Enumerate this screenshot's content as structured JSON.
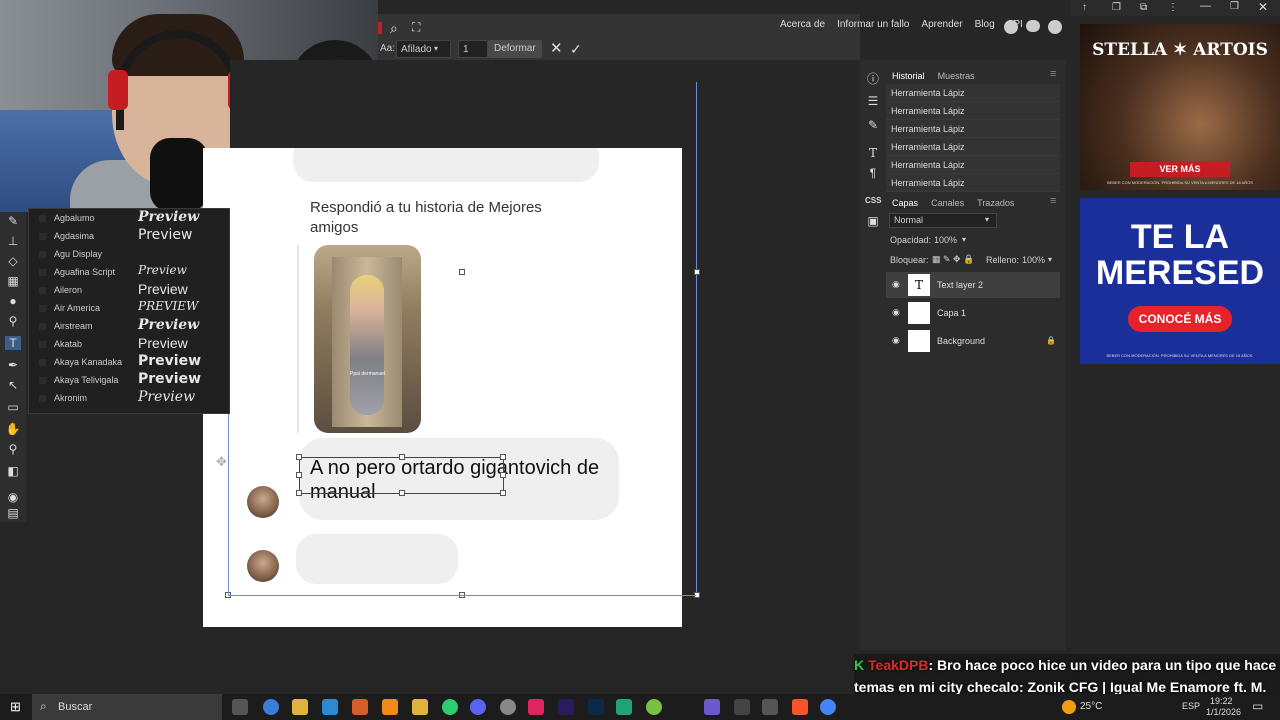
{
  "app": {
    "toolbar": {
      "font_size_label": "Aa:",
      "antialias_value": "Afilado",
      "size_value": "1",
      "deform_label": "Deformar"
    },
    "menu": [
      "Acerca de",
      "Informar un fallo",
      "Aprender",
      "Blog",
      "API"
    ],
    "font_list": [
      {
        "name": "Agbalumo",
        "preview": "Preview"
      },
      {
        "name": "Agdasima",
        "preview": "Preview"
      },
      {
        "name": "Agu Display",
        "preview": ""
      },
      {
        "name": "Aguafina Script",
        "preview": "Preview"
      },
      {
        "name": "Aileron",
        "preview": "Preview"
      },
      {
        "name": "Air America",
        "preview": "PREVIEW"
      },
      {
        "name": "Airstream",
        "preview": "Preview"
      },
      {
        "name": "Akatab",
        "preview": "Preview"
      },
      {
        "name": "Akaya Kanadaka",
        "preview": "Preview"
      },
      {
        "name": "Akaya Telivigala",
        "preview": "Preview"
      },
      {
        "name": "Akronim",
        "preview": "Preview"
      }
    ],
    "canvas": {
      "story_text": "Respondió a tu historia de Mejores amigos",
      "story_caption": "Ppai dermanuel",
      "message_text": "A no pero ortardo gigantovich de manual"
    },
    "panels": {
      "history_tabs": [
        "Historial",
        "Muestras"
      ],
      "history_items": [
        "Herramienta Lápiz",
        "Herramienta Lápiz",
        "Herramienta Lápiz",
        "Herramienta Lápiz",
        "Herramienta Lápiz",
        "Herramienta Lápiz"
      ],
      "layer_tabs": [
        "Capas",
        "Canales",
        "Trazados"
      ],
      "blend_mode": "Normal",
      "opacity_label": "Opacidad:",
      "opacity_value": "100%",
      "lock_label": "Bloquear:",
      "fill_label": "Relleno:",
      "fill_value": "100%",
      "layers": [
        {
          "name": "Text layer 2",
          "thumb": "T"
        },
        {
          "name": "Capa 1",
          "thumb": ""
        },
        {
          "name": "Background",
          "thumb": ""
        }
      ]
    },
    "side_labels": [
      "CSS"
    ]
  },
  "ads": {
    "ad1": {
      "brand": "STELLA ✶ ARTOIS",
      "cta": "VER MÁS",
      "disclaimer": "BEBER CON MODERACIÓN. PROHIBIDA SU VENTA A MENORES DE 18 AÑOS"
    },
    "ad2": {
      "line1": "TE LA",
      "line2": "MERESED",
      "cta": "CONOCÉ MÁS",
      "disclaimer": "BEBER CON MODERACIÓN. PROHIBIDA SU VENTA A MENORES DE 18 AÑOS."
    }
  },
  "chat": {
    "user": "TeakDPB",
    "message": ": Bro hace poco hice un video para un tipo que hace temas en mi city checalo: Zonik CFG | Igual Me Enamore ft. M. Ocean (VideoClip Oficial)"
  },
  "taskbar": {
    "search_placeholder": "Buscar",
    "temperature": "25°C",
    "language": "ESP",
    "time": "19:22",
    "date": "1/1/2026"
  },
  "colors": {
    "accent_red": "#c41d23",
    "chat_user": "#e02a2a",
    "ad2_bg": "#1a2f9a"
  }
}
